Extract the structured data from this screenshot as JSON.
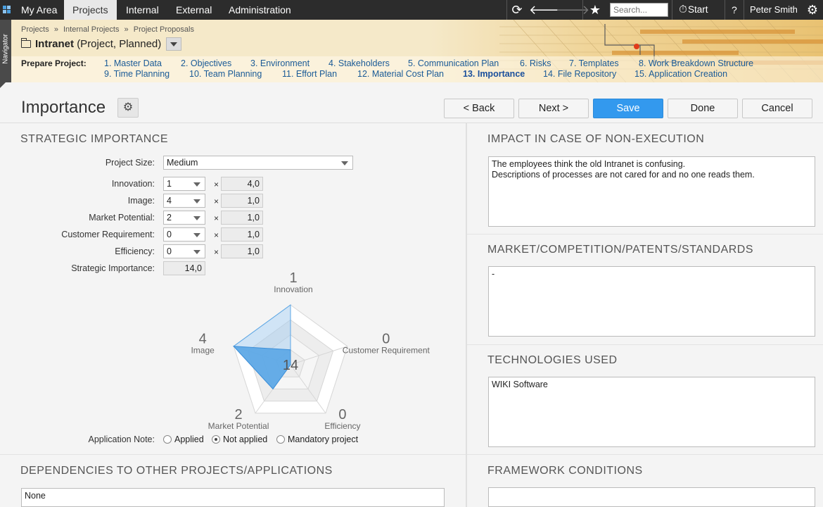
{
  "topbar": {
    "tabs": [
      {
        "label": "My Area",
        "active": false
      },
      {
        "label": "Projects",
        "active": true
      },
      {
        "label": "Internal",
        "active": false
      },
      {
        "label": "External",
        "active": false
      },
      {
        "label": "Administration",
        "active": false
      }
    ],
    "search_placeholder": "Search...",
    "start_label": "Start",
    "help_label": "?",
    "user_name": "Peter Smith",
    "icons": [
      "refresh-icon",
      "back-arrow-icon",
      "forward-arrow-icon",
      "star-icon",
      "timer-icon",
      "gear-icon"
    ]
  },
  "navigator": {
    "label": "Navigator"
  },
  "header": {
    "breadcrumbs": [
      "Projects",
      "Internal Projects",
      "Project Proposals"
    ],
    "breadcrumb_sep": "»",
    "project_name": "Intranet",
    "project_meta": "(Project, Planned)",
    "steps_label": "Prepare Project:",
    "steps": [
      "1. Master Data",
      "2. Objectives",
      "3. Environment",
      "4. Stakeholders",
      "5. Communication Plan",
      "6. Risks",
      "7. Templates",
      "8. Work Breakdown Structure",
      "9. Time Planning",
      "10. Team Planning",
      "11. Effort Plan",
      "12. Material Cost Plan",
      "13. Importance",
      "14. File Repository",
      "15. Application Creation"
    ],
    "active_step": 12
  },
  "page": {
    "title": "Importance",
    "buttons": {
      "back": "< Back",
      "next": "Next >",
      "save": "Save",
      "done": "Done",
      "cancel": "Cancel"
    }
  },
  "strategic": {
    "heading": "STRATEGIC IMPORTANCE",
    "project_size_label": "Project Size:",
    "project_size_value": "Medium",
    "factors": [
      {
        "label": "Innovation:",
        "value": "1",
        "weight": "4,0"
      },
      {
        "label": "Image:",
        "value": "4",
        "weight": "1,0"
      },
      {
        "label": "Market Potential:",
        "value": "2",
        "weight": "1,0"
      },
      {
        "label": "Customer Requirement:",
        "value": "0",
        "weight": "1,0"
      },
      {
        "label": "Efficiency:",
        "value": "0",
        "weight": "1,0"
      }
    ],
    "times_symbol": "×",
    "total_label": "Strategic Importance:",
    "total_value": "14,0",
    "application_note_label": "Application Note:",
    "application_note_options": [
      "Applied",
      "Not applied",
      "Mandatory project"
    ],
    "application_note_selected": 1
  },
  "chart_data": {
    "type": "radar",
    "axes": [
      "Innovation",
      "Customer Requirement",
      "Efficiency",
      "Market Potential",
      "Image"
    ],
    "values": [
      1,
      0,
      0,
      2,
      4
    ],
    "weighted_values": [
      4,
      0,
      0,
      2,
      4
    ],
    "max": 4,
    "center_label": "14",
    "colors": {
      "weighted": "#5aa6e6",
      "raw": "#a9cdef",
      "grid": "#d6d6d6"
    }
  },
  "panels": {
    "impact": {
      "heading": "IMPACT IN CASE OF NON-EXECUTION",
      "text": "The employees think the old Intranet is confusing.\nDescriptions of processes are not cared for and no one reads them."
    },
    "market": {
      "heading": "MARKET/COMPETITION/PATENTS/STANDARDS",
      "text": "-"
    },
    "technologies": {
      "heading": "TECHNOLOGIES USED",
      "text": "WIKI Software"
    },
    "dependencies": {
      "heading": "DEPENDENCIES TO OTHER PROJECTS/APPLICATIONS",
      "text": "None"
    },
    "framework": {
      "heading": "FRAMEWORK CONDITIONS",
      "text": ""
    }
  }
}
